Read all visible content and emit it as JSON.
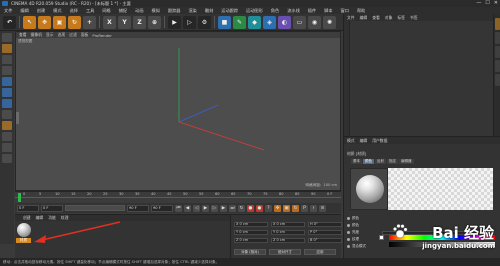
{
  "app": {
    "title": "CINEMA 4D R20.059 Studio (RC - R20) - [未标题 1 *] - 主要",
    "window_buttons": [
      "—",
      "☐",
      "✕"
    ]
  },
  "menu": [
    "文件",
    "编辑",
    "创建",
    "模式",
    "选择",
    "工具",
    "网格",
    "捕捉",
    "动画",
    "模拟",
    "跟踪器",
    "渲染",
    "雕刻",
    "运动跟踪",
    "运动图形",
    "角色",
    "流水线",
    "插件",
    "脚本",
    "窗口",
    "帮助"
  ],
  "toolbar": {
    "letters": [
      "X",
      "Y",
      "Z"
    ]
  },
  "viewport": {
    "tabs": [
      "查看",
      "摄像机",
      "显示",
      "选项",
      "过滤",
      "面板",
      "ProRender"
    ],
    "label": "透视视图",
    "scale": "网格间距：100 cm"
  },
  "timeline": {
    "ticks": [
      "0",
      "5",
      "10",
      "15",
      "20",
      "25",
      "30",
      "35",
      "40",
      "45",
      "50",
      "55",
      "60",
      "65",
      "70",
      "75",
      "80",
      "85",
      "90"
    ],
    "frame_end": "0 F"
  },
  "playbar": {
    "start": "0 F",
    "current": "0 F",
    "end": "90 F",
    "max": "90 F"
  },
  "materials": {
    "menu": [
      "创建",
      "编辑",
      "功能",
      "纹理"
    ],
    "item_label": "材质"
  },
  "coords": {
    "rows": [
      [
        "X 0 cm",
        "X 0 cm",
        "H 0°"
      ],
      [
        "Y 0 cm",
        "Y 0 cm",
        "P 0°"
      ],
      [
        "Z 0 cm",
        "Z 0 cm",
        "B 0°"
      ]
    ],
    "buttons": [
      "对象 (相对)",
      "绝对尺寸",
      "应用"
    ]
  },
  "objects_panel": {
    "menu": [
      "文件",
      "编辑",
      "查看",
      "对象",
      "标签",
      "书签"
    ]
  },
  "attributes": {
    "menu": [
      "模式",
      "编辑",
      "用户数据"
    ],
    "subtitle": "材质 [材质]",
    "tabs": [
      "基本",
      "颜色",
      "反射",
      "指定",
      "编辑器"
    ],
    "section": "颜色",
    "rows": [
      "颜色",
      "亮度",
      "纹理",
      "混合模式"
    ]
  },
  "status": {
    "text": "移动：点击并拖动鼠标移动元素。按住 SHIFT 键量化移动；节点编辑模式时按住 SHIFT 键增加选择对象；按住 CTRL 键减少选择对象。"
  },
  "watermark": {
    "text": "Bai 经验",
    "url": "jingyan.baidu.com"
  },
  "colors": {
    "accent_orange": "#d88a1c",
    "timeline_cursor": "#2fb84b",
    "arrow_red": "#e03020"
  }
}
